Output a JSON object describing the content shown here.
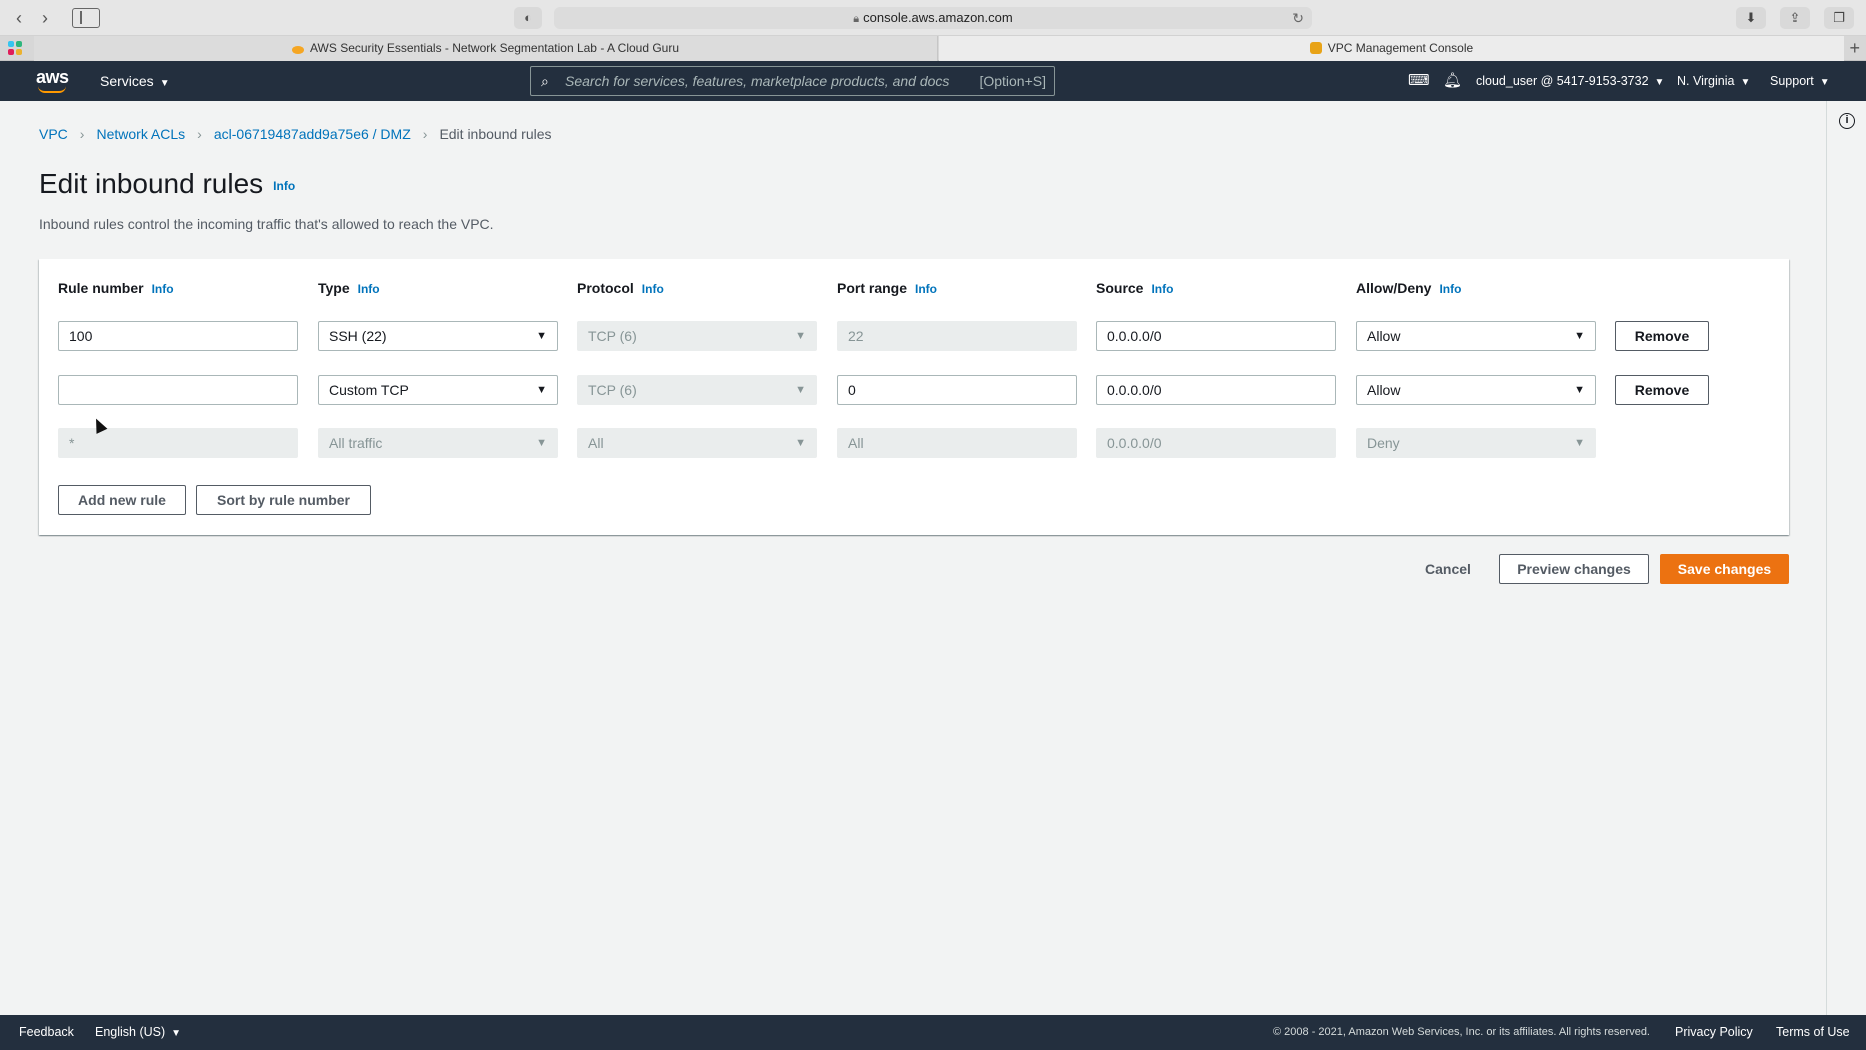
{
  "browser": {
    "url": "console.aws.amazon.com",
    "tabs": [
      {
        "label": "AWS Security Essentials - Network Segmentation Lab - A Cloud Guru"
      },
      {
        "label": "VPC Management Console"
      }
    ]
  },
  "nav": {
    "logo_text": "aws",
    "services_label": "Services",
    "search_placeholder": "Search for services, features, marketplace products, and docs",
    "search_hint": "[Option+S]",
    "account": "cloud_user @ 5417-9153-3732",
    "region": "N. Virginia",
    "support": "Support"
  },
  "breadcrumb": [
    "VPC",
    "Network ACLs",
    "acl-06719487add9a75e6 / DMZ",
    "Edit inbound rules"
  ],
  "page": {
    "title": "Edit inbound rules",
    "info": "Info",
    "description": "Inbound rules control the incoming traffic that's allowed to reach the VPC."
  },
  "table": {
    "headers": [
      "Rule number",
      "Type",
      "Protocol",
      "Port range",
      "Source",
      "Allow/Deny"
    ],
    "info": "Info",
    "rows": [
      {
        "rule": "100",
        "type": "SSH (22)",
        "protocol": "TCP (6)",
        "port": "22",
        "source": "0.0.0.0/0",
        "action": "Allow",
        "remove": "Remove"
      },
      {
        "rule": "",
        "type": "Custom TCP",
        "protocol": "TCP (6)",
        "port": "0",
        "source": "0.0.0.0/0",
        "action": "Allow",
        "remove": "Remove"
      },
      {
        "rule": "*",
        "type": "All traffic",
        "protocol": "All",
        "port": "All",
        "source": "0.0.0.0/0",
        "action": "Deny"
      }
    ],
    "add_rule": "Add new rule",
    "sort_rule": "Sort by rule number"
  },
  "actions": {
    "cancel": "Cancel",
    "preview": "Preview changes",
    "save": "Save changes"
  },
  "footer": {
    "feedback": "Feedback",
    "language": "English (US)",
    "copyright": "© 2008 - 2021, Amazon Web Services, Inc. or its affiliates. All rights reserved.",
    "privacy": "Privacy Policy",
    "terms": "Terms of Use"
  },
  "colors": {
    "nav_bg": "#232f3e",
    "link": "#0073bb",
    "primary": "#ec7211"
  }
}
